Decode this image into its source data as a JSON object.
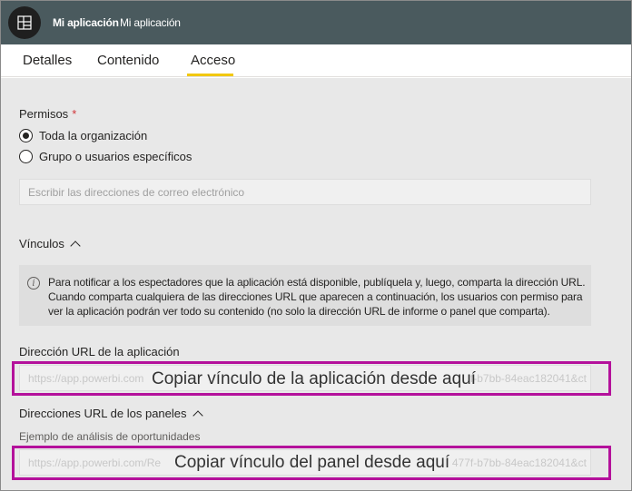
{
  "header": {
    "title": "Mi aplicación",
    "subtitle": "Mi aplicación",
    "background": "#4a5a5e"
  },
  "tabs": [
    {
      "label": "Detalles"
    },
    {
      "label": "Contenido"
    },
    {
      "label": "Acceso",
      "active": true
    }
  ],
  "accent": "#f2c811",
  "permissions": {
    "label": "Permisos",
    "required_mark": "*",
    "options": [
      {
        "label": "Toda la organización",
        "checked": true
      },
      {
        "label": "Grupo o usuarios específicos",
        "checked": false
      }
    ],
    "email_placeholder": "Escribir las direcciones de correo electrónico"
  },
  "links": {
    "label": "Vínculos",
    "info_icon": "info-icon",
    "info_text": "Para notificar a los espectadores que la aplicación está disponible, publíquela y, luego, comparta la dirección URL. Cuando comparta cualquiera de las direcciones URL que aparecen a continuación, los usuarios con permiso para ver la aplicación podrán ver todo su contenido (no solo la dirección URL de informe o panel que comparta)."
  },
  "app_url": {
    "label": "Dirección URL de la aplicación",
    "value_start": "https://app.powerbi.com",
    "value_end": "f-b7bb-84eac182041&ct",
    "callout": "Copiar vínculo de la aplicación desde aquí"
  },
  "dashboard_urls": {
    "label": "Direcciones URL de los paneles",
    "dashboard_name": "Ejemplo de análisis de oportunidades",
    "value_start": "https://app.powerbi.com/Re",
    "value_end": "477f-b7bb-84eac182041&ct",
    "callout": "Copiar vínculo del panel desde aquí"
  },
  "callout_color": "#b4119b"
}
